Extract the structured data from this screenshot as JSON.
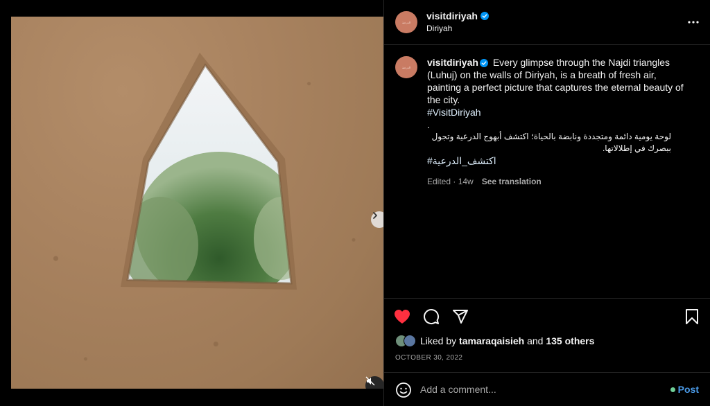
{
  "post": {
    "username": "visitdiriyah",
    "location": "Diriyah",
    "avatar_mark": "الدرعية",
    "caption_en": "Every glimpse through the Najdi triangles (Luhuj) on the walls of Diriyah, is a breath of fresh air, painting a perfect picture that captures the eternal beauty of the city.",
    "hashtag_en": "#VisitDiriyah",
    "separator": ".",
    "caption_ar": "لوحة يومية دائمة ومتجددة ونابضة بالحياة؛ اكتشف أبهوج الدرعية وتجول ببصرك في إطلالاتها.",
    "hashtag_ar": "#اكتشف_الدرعية",
    "edited_label": "Edited · 14w",
    "see_translation": "See translation"
  },
  "likes": {
    "prefix": "Liked by",
    "user": "tamaraqaisieh",
    "and_label": "and",
    "others": "135 others"
  },
  "date": "OCTOBER 30, 2022",
  "comment": {
    "placeholder": "Add a comment...",
    "post_label": "Post"
  },
  "carousel": {
    "slides": 3,
    "active_index": 0
  },
  "colors": {
    "like_red": "#ff3040",
    "verified_blue": "#0095f6",
    "post_blue": "#4b9be8",
    "avatar_bg": "#c97b63"
  },
  "icons": {
    "verified": "verified-badge-icon",
    "more": "more-horizontal-icon",
    "like": "heart-filled-icon",
    "comment": "comment-bubble-icon",
    "share": "paper-plane-icon",
    "save": "bookmark-icon",
    "next": "chevron-right-icon",
    "mute": "speaker-muted-icon",
    "emoji": "smiley-icon"
  }
}
